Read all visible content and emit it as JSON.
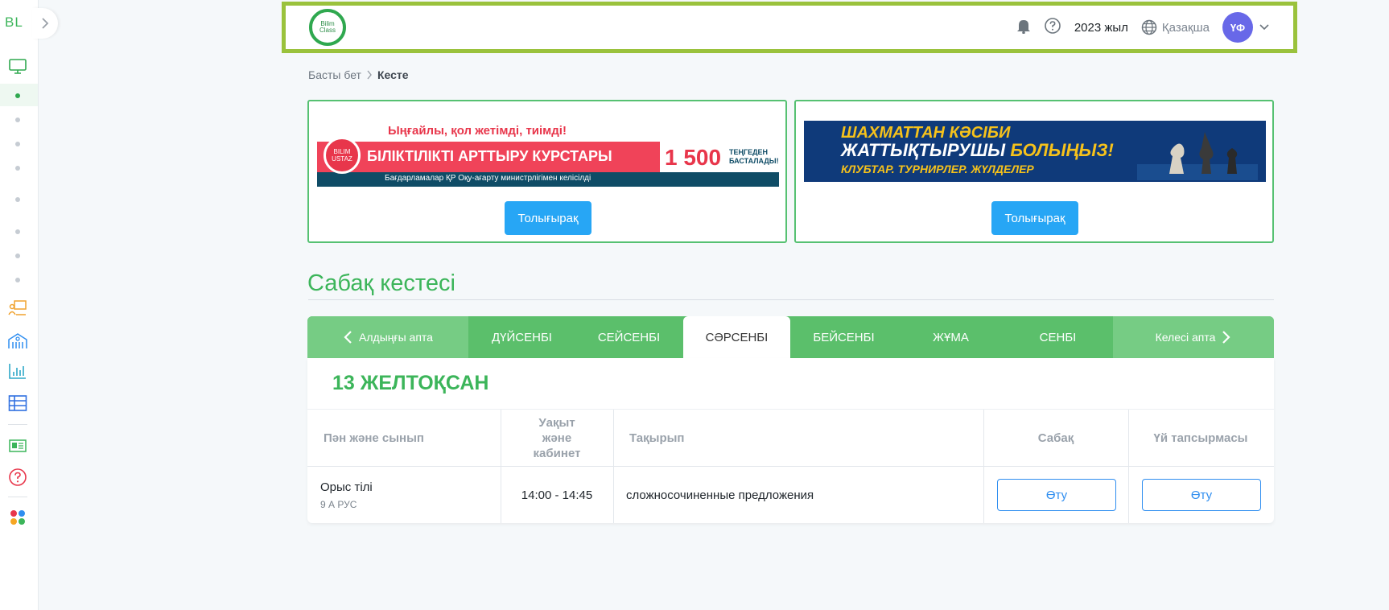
{
  "sidebar": {
    "logo_text": "BL"
  },
  "header": {
    "brand_line1": "Bilim",
    "brand_line2": "Class",
    "year": "2023 жыл",
    "language": "Қазақша",
    "avatar_initials": "ҮФ"
  },
  "breadcrumb": {
    "home": "Басты бет",
    "current": "Кесте"
  },
  "banners": [
    {
      "headline": "Ыңғайлы, қол жетімді, тиімді!",
      "title": "БІЛІКТІЛІКТІ АРТТЫРУ КУРСТАРЫ",
      "note": "Бағдарламалар ҚР Оқу-ағарту министрлігімен келісілді",
      "price": "1 500",
      "price_sub1": "ТЕҢГЕДЕН",
      "price_sub2": "БАСТАЛАДЫ!",
      "logo_text": "BILIM USTAZ",
      "button_label": "Толығырақ"
    },
    {
      "line1": "ШАХМАТТАН КӘСІБИ",
      "line2_a": "ЖАТТЫҚТЫРУШЫ",
      "line2_b": "БОЛЫҢЫЗ!",
      "line3": "КЛУБТАР. ТУРНИРЛЕР. ЖҮЛДЕЛЕР",
      "button_label": "Толығырақ"
    }
  ],
  "schedule": {
    "title": "Сабақ кестесі",
    "prev_week": "Алдыңғы апта",
    "next_week": "Келесі апта",
    "days": [
      "ДҮЙСЕНБІ",
      "СЕЙСЕНБІ",
      "СӘРСЕНБІ",
      "БЕЙСЕНБІ",
      "ЖҰМА",
      "СЕНБІ"
    ],
    "active_day": "СӘРСЕНБІ",
    "date": "13 ЖЕЛТОҚСАН",
    "columns": [
      "Пән және сынып",
      "Уақыт және кабинет",
      "Тақырып",
      "Сабақ",
      "Үй тапсырмасы"
    ],
    "rows": [
      {
        "subject": "Орыс тілі",
        "class": "9 А РУС",
        "time": "14:00 - 14:45",
        "topic": "сложносочиненные предложения",
        "lesson_button": "Өту",
        "homework_button": "Өту"
      }
    ]
  },
  "colors": {
    "green": "#3cb55a",
    "header_border": "#9ac23c",
    "primary_blue": "#27a6f5",
    "avatar": "#6868e8"
  }
}
